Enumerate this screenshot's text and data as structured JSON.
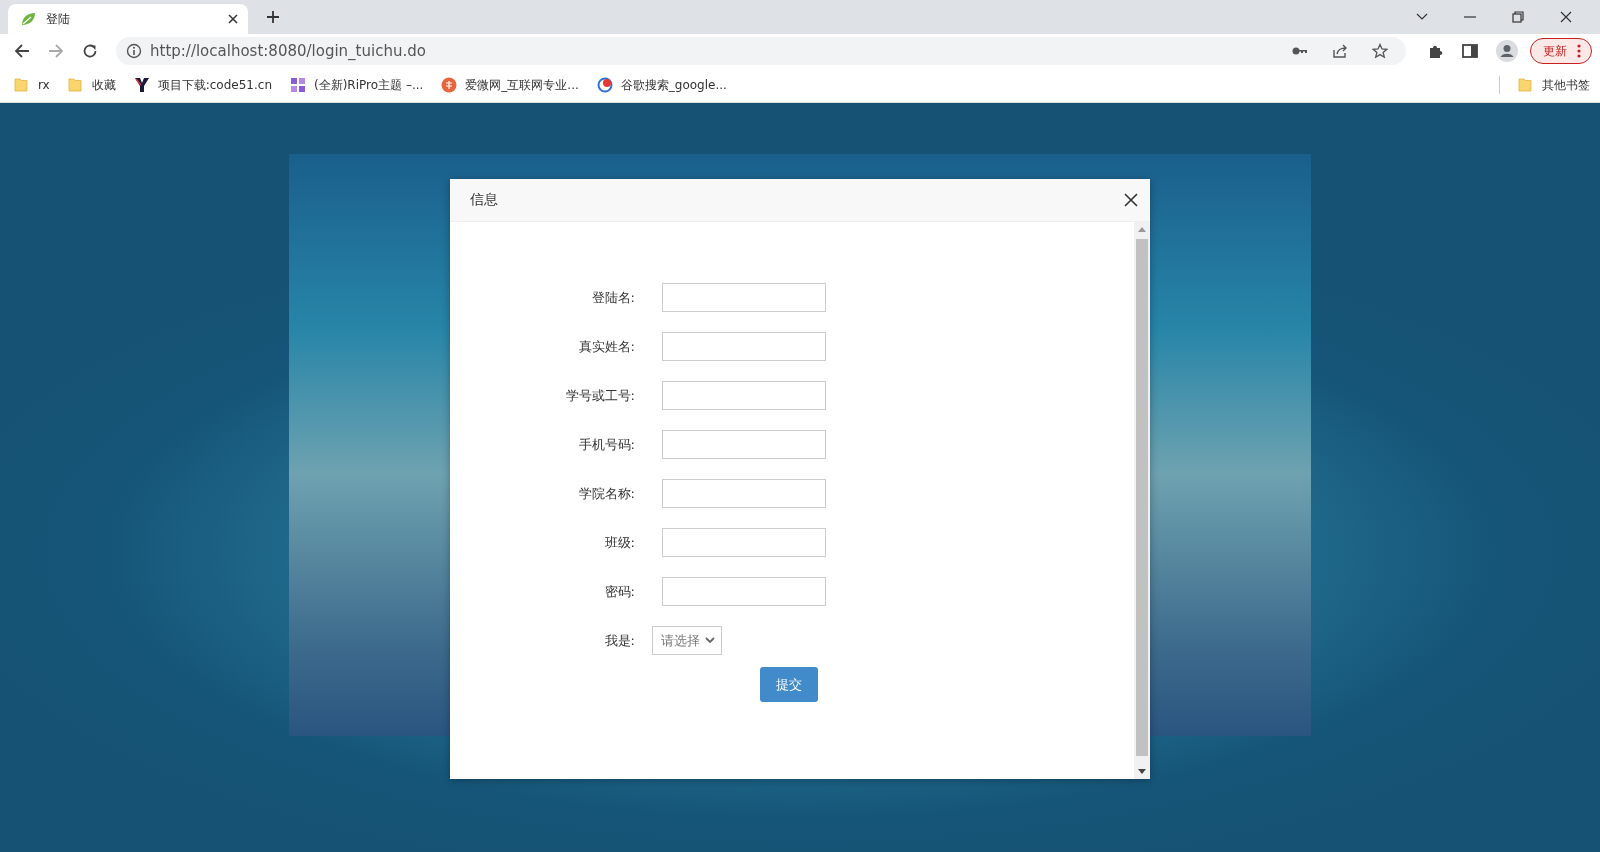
{
  "browser": {
    "tab": {
      "title": "登陆",
      "selected": true
    },
    "address": {
      "url": "http://localhost:8080/login_tuichu.do"
    },
    "update_button": "更新",
    "bookmarks": [
      {
        "label": "rx",
        "kind": "folder"
      },
      {
        "label": "收藏",
        "kind": "folder"
      },
      {
        "label": "项目下载:code51.cn",
        "kind": "y"
      },
      {
        "label": "(全新)RiPro主题 –...",
        "kind": "square"
      },
      {
        "label": "爱微网_互联网专业...",
        "kind": "orange"
      },
      {
        "label": "谷歌搜索_google...",
        "kind": "ring"
      }
    ],
    "other_bookmarks": "其他书签"
  },
  "dialog": {
    "title": "信息",
    "fields": [
      {
        "label": "登陆名:",
        "kind": "text"
      },
      {
        "label": "真实姓名:",
        "kind": "text"
      },
      {
        "label": "学号或工号:",
        "kind": "text"
      },
      {
        "label": "手机号码:",
        "kind": "text"
      },
      {
        "label": "学院名称:",
        "kind": "text"
      },
      {
        "label": "班级:",
        "kind": "text"
      },
      {
        "label": "密码:",
        "kind": "text"
      },
      {
        "label": "我是:",
        "kind": "select",
        "value": "请选择"
      }
    ],
    "submit": "提交"
  }
}
